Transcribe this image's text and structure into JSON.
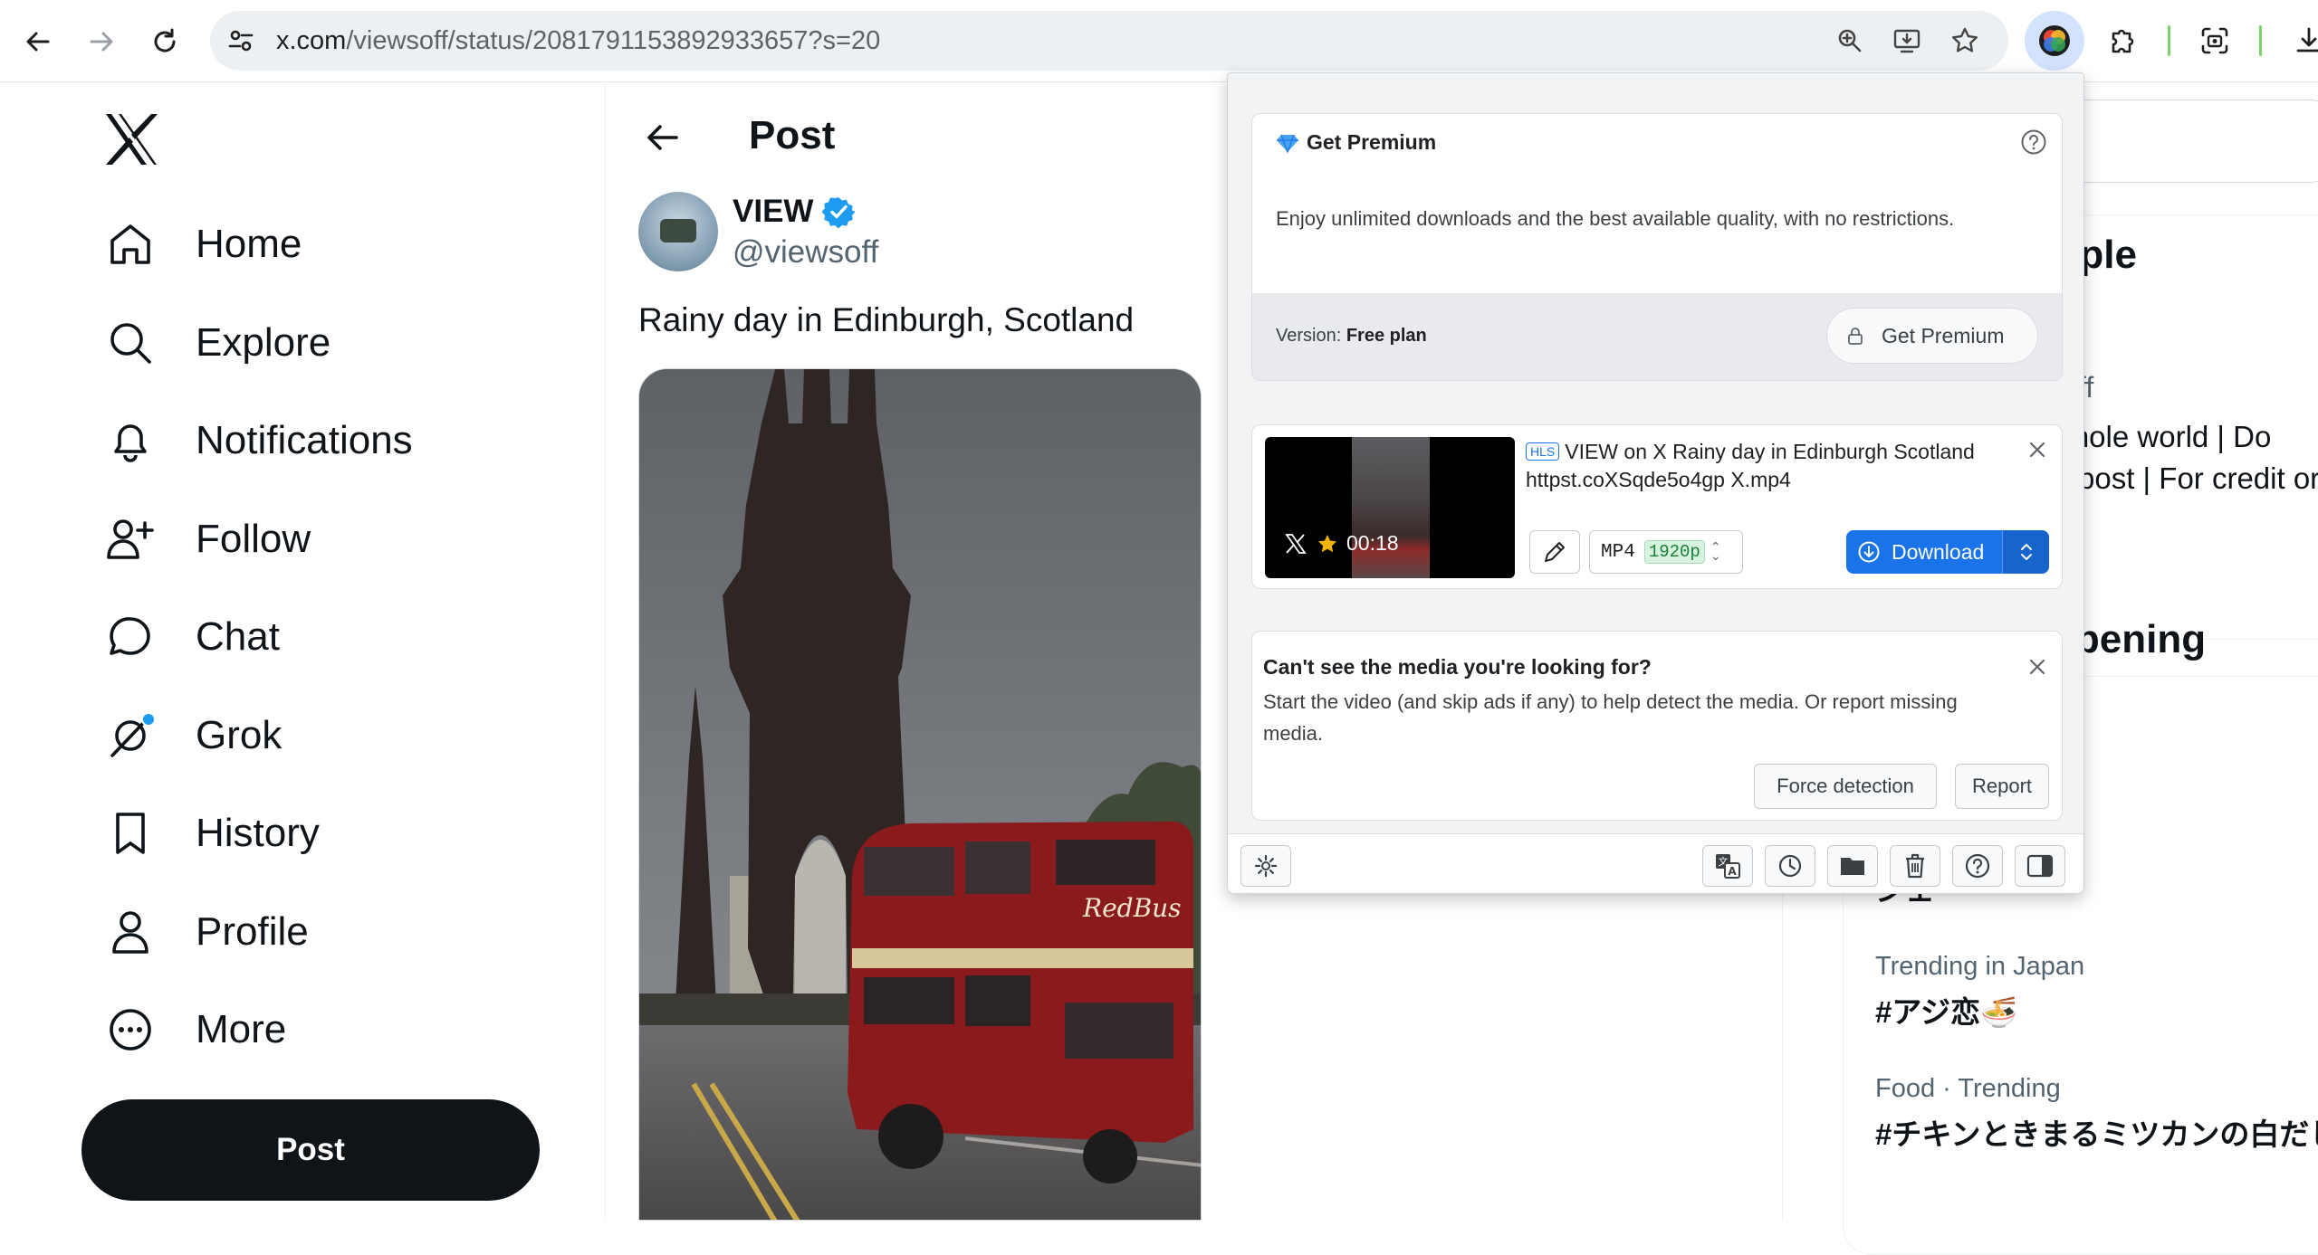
{
  "browser": {
    "url_host": "x.com",
    "url_path": "/viewsoff/status/2081791153892933657?s=20",
    "icons": [
      "back-icon",
      "forward-icon",
      "reload-icon",
      "site-settings-icon",
      "zoom-icon",
      "install-app-icon",
      "bookmark-star-icon",
      "extension-downloader-icon",
      "extensions-puzzle-icon",
      "screenshot-icon",
      "downloads-icon"
    ]
  },
  "sidebar": {
    "items": [
      {
        "label": "Home",
        "icon": "home-icon"
      },
      {
        "label": "Explore",
        "icon": "search-icon"
      },
      {
        "label": "Notifications",
        "icon": "bell-icon"
      },
      {
        "label": "Follow",
        "icon": "follow-icon"
      },
      {
        "label": "Chat",
        "icon": "chat-icon"
      },
      {
        "label": "Grok",
        "icon": "grok-icon"
      },
      {
        "label": "History",
        "icon": "bookmark-icon"
      },
      {
        "label": "Profile",
        "icon": "profile-icon"
      },
      {
        "label": "More",
        "icon": "more-icon"
      }
    ],
    "post_button": "Post"
  },
  "main": {
    "header_title": "Post",
    "author_name": "VIEW",
    "author_handle": "@viewsoff",
    "tweet_text": "Rainy day in Edinburgh, Scotland",
    "bus_sign": "RedBus"
  },
  "right": {
    "people_heading": "eople",
    "profile_handle_fragment": "ff",
    "bio_line1": "whole world | Do",
    "bio_line2": "post | For credit or",
    "happening_heading": "ppening",
    "trend_partial": "ジェ",
    "trend1_context": "Trending in Japan",
    "trend1_name": "#アジ恋",
    "trend1_emoji": "🍜",
    "trend2_context": "Food · Trending",
    "trend2_name": "#チキンときまるミツカンの白だし"
  },
  "popup": {
    "premium": {
      "title": "Get Premium",
      "description": "Enjoy unlimited downloads and the best available quality, with no restrictions.",
      "version_label": "Version:",
      "version_value": "Free plan",
      "button": "Get Premium"
    },
    "media": {
      "badge": "HLS",
      "title": "VIEW on X Rainy day in Edinburgh Scotland httpst.coXSqde5o4gp X.mp4",
      "duration": "00:18",
      "format": "MP4",
      "resolution": "1920p",
      "download_label": "Download"
    },
    "missing": {
      "title": "Can't see the media you're looking for?",
      "description": "Start the video (and skip ads if any) to help detect the media. Or report missing media.",
      "force_button": "Force detection",
      "report_button": "Report"
    },
    "bottom_icons": [
      "settings-icon",
      "translate-icon",
      "history-clock-icon",
      "folder-icon",
      "trash-icon",
      "help-icon",
      "sidebar-panel-icon"
    ]
  }
}
